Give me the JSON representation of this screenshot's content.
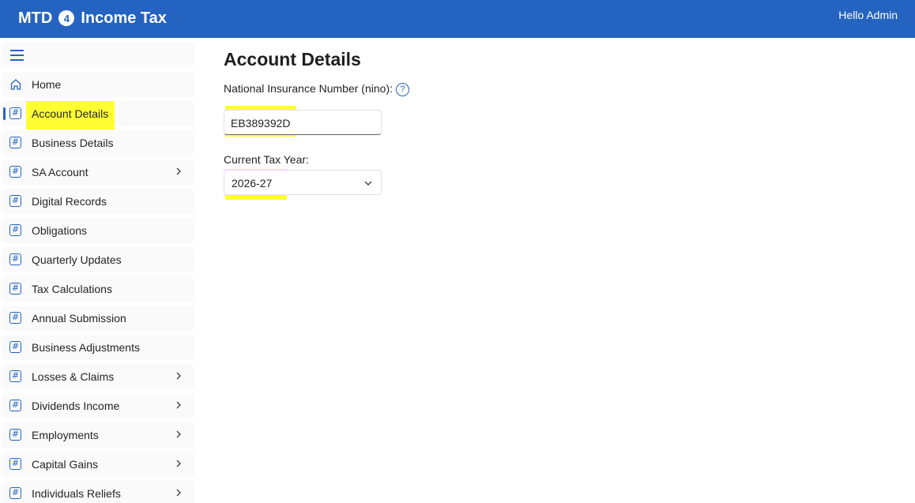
{
  "app": {
    "brand_prefix": "MTD",
    "brand_number": "4",
    "brand_suffix": "Income Tax",
    "greeting": "Hello Admin"
  },
  "sidebar": {
    "items": [
      {
        "label": "Home",
        "icon": "home-icon",
        "has_chevron": false
      },
      {
        "label": "Account Details",
        "icon": "hash-icon",
        "has_chevron": false,
        "active": true
      },
      {
        "label": "Business Details",
        "icon": "hash-icon",
        "has_chevron": false
      },
      {
        "label": "SA Account",
        "icon": "hash-icon",
        "has_chevron": true
      },
      {
        "label": "Digital Records",
        "icon": "hash-icon",
        "has_chevron": false
      },
      {
        "label": "Obligations",
        "icon": "hash-icon",
        "has_chevron": false
      },
      {
        "label": "Quarterly Updates",
        "icon": "hash-icon",
        "has_chevron": false
      },
      {
        "label": "Tax Calculations",
        "icon": "hash-icon",
        "has_chevron": false
      },
      {
        "label": "Annual Submission",
        "icon": "hash-icon",
        "has_chevron": false
      },
      {
        "label": "Business Adjustments",
        "icon": "hash-icon",
        "has_chevron": false
      },
      {
        "label": "Losses & Claims",
        "icon": "hash-icon",
        "has_chevron": true
      },
      {
        "label": "Dividends Income",
        "icon": "hash-icon",
        "has_chevron": true
      },
      {
        "label": "Employments",
        "icon": "hash-icon",
        "has_chevron": true
      },
      {
        "label": "Capital Gains",
        "icon": "hash-icon",
        "has_chevron": true
      },
      {
        "label": "Individuals Reliefs",
        "icon": "hash-icon",
        "has_chevron": true
      }
    ]
  },
  "main": {
    "title": "Account Details",
    "nino_label": "National Insurance Number (nino):",
    "nino_value": "EB389392D",
    "tax_year_label": "Current Tax Year:",
    "tax_year_value": "2026-27"
  },
  "colors": {
    "brand": "#2563c0",
    "highlight": "#ffff33"
  }
}
